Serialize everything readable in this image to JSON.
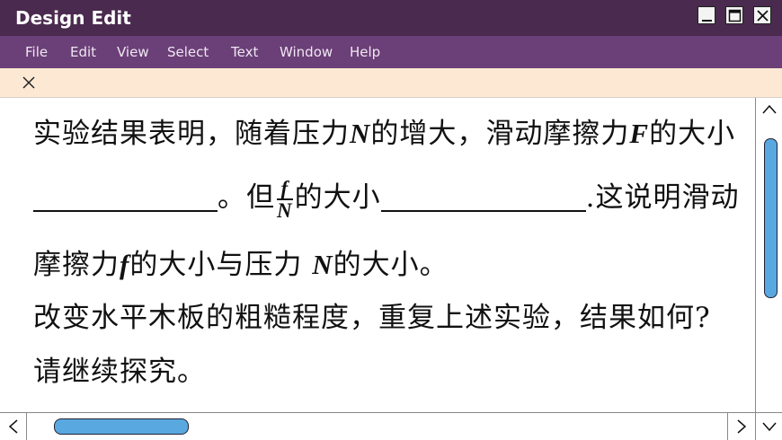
{
  "window": {
    "title": "Design Edit",
    "minimize_icon": "minimize-icon",
    "maximize_icon": "maximize-icon",
    "close_icon": "close-icon"
  },
  "menu": {
    "items": [
      "File",
      "Edit",
      "View",
      "Select",
      "Text",
      "Window",
      "Help"
    ]
  },
  "tab": {
    "close_icon": "close-icon"
  },
  "document": {
    "line1": {
      "a": "实验结果表明，随着压力",
      "b": "N",
      "c": "的增大，滑动摩擦力",
      "d": "F",
      "e": "的大小"
    },
    "line2": {
      "a": "。但",
      "frac_num": "f",
      "frac_den": "N",
      "b": "的大小",
      "c": ".这说明滑动"
    },
    "line3": {
      "a": "摩擦力",
      "b": "f",
      "c": "的大小与压力 ",
      "d": "N",
      "e": "的大小。"
    },
    "line4": "改变水平木板的粗糙程度，重复上述实验，结果如何?",
    "line5": "请继续探究。"
  },
  "colors": {
    "titlebar": "#4a2a4e",
    "menubar": "#6b3f77",
    "tabstrip": "#fde9d3",
    "scroll_thumb": "#5aa8e0"
  }
}
